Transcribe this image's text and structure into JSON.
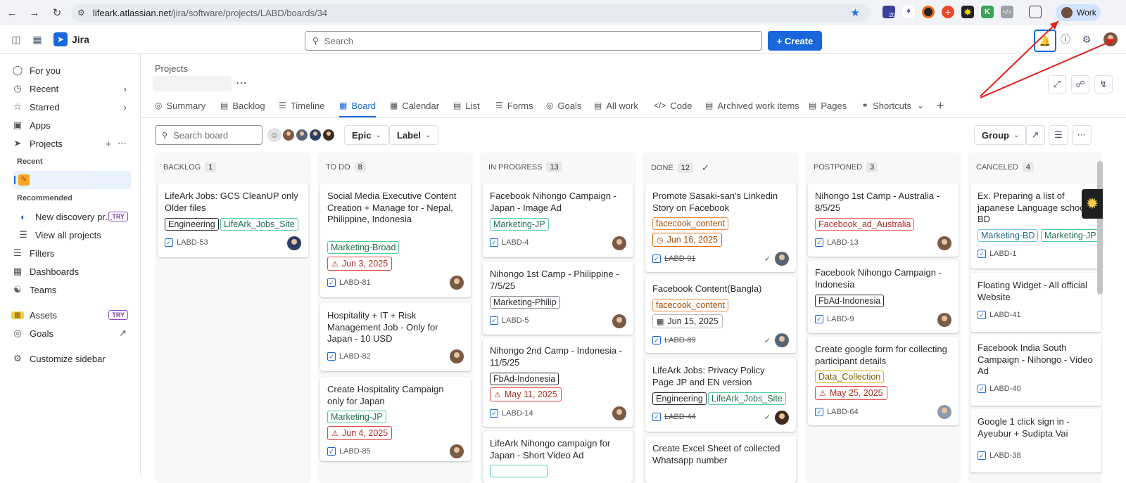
{
  "browser": {
    "url_host": "lifeark.atlassian.net",
    "url_path": "/jira/software/projects/LABD/boards/34",
    "ext_badge": "20",
    "profile_label": "Work"
  },
  "topbar": {
    "app_name": "Jira",
    "search_placeholder": "Search",
    "create_label": "Create"
  },
  "sidebar": {
    "for_you": "For you",
    "recent": "Recent",
    "starred": "Starred",
    "apps": "Apps",
    "projects": "Projects",
    "recent_label": "Recent",
    "recommended_label": "Recommended",
    "new_discovery": "New discovery pr...",
    "try": "TRY",
    "view_all": "View all projects",
    "filters": "Filters",
    "dashboards": "Dashboards",
    "teams": "Teams",
    "assets": "Assets",
    "goals": "Goals",
    "customize": "Customize sidebar"
  },
  "header": {
    "projects_label": "Projects"
  },
  "tabs": [
    "Summary",
    "Backlog",
    "Timeline",
    "Board",
    "Calendar",
    "List",
    "Forms",
    "Goals",
    "All work",
    "Code",
    "Archived work items",
    "Pages",
    "Shortcuts"
  ],
  "toolbar": {
    "search_placeholder": "Search board",
    "epic": "Epic",
    "label": "Label",
    "group": "Group"
  },
  "columns": [
    {
      "name": "BACKLOG",
      "count": "1",
      "cards": [
        {
          "title": "LifeArk Jobs: GCS CleanUP only Older files",
          "labels": [
            "Engineering",
            "LifeArk_Jobs_Site"
          ],
          "key": "LABD-53"
        }
      ]
    },
    {
      "name": "TO DO",
      "count": "8",
      "cards": [
        {
          "title": "Social Media Executive Content Creation + Manage for - Nepal, Philippine, Indonesia",
          "labels": [
            "Marketing-Broad"
          ],
          "due": "Jun 3, 2025",
          "key": "LABD-81"
        },
        {
          "title": "Hospitality + IT + Risk Management Job - Only for Japan - 10 USD",
          "key": "LABD-82"
        },
        {
          "title": "Create Hospitality Campaign only for Japan",
          "labels": [
            "Marketing-JP"
          ],
          "due": "Jun 4, 2025",
          "key": "LABD-85"
        }
      ]
    },
    {
      "name": "IN PROGRESS",
      "count": "13",
      "cards": [
        {
          "title": "Facebook Nihongo Campaign - Japan - Image Ad",
          "labels": [
            "Marketing-JP"
          ],
          "key": "LABD-4"
        },
        {
          "title": "Nihongo 1st Camp - Philippine - 7/5/25",
          "labels": [
            "Marketing-Philip"
          ],
          "key": "LABD-5"
        },
        {
          "title": "Nihongo 2nd Camp - Indonesia - 11/5/25",
          "labels": [
            "FbAd-Indonesia"
          ],
          "due": "May 11, 2025",
          "key": "LABD-14"
        },
        {
          "title": "LifeArk Nihongo campaign for Japan - Short Video Ad"
        }
      ]
    },
    {
      "name": "DONE",
      "count": "12",
      "cards": [
        {
          "title": "Promote Sasaki-san's Linkedin Story on Facebook",
          "labels": [
            "facecook_content"
          ],
          "due": "Jun 16, 2025",
          "key": "LABD-91"
        },
        {
          "title": "Facebook Content(Bangla)",
          "labels": [
            "facecook_content"
          ],
          "due": "Jun 15, 2025",
          "key": "LABD-89"
        },
        {
          "title": "LifeArk Jobs: Privacy Policy Page JP and EN version",
          "labels": [
            "Engineering",
            "LifeArk_Jobs_Site"
          ],
          "key": "LABD-44"
        },
        {
          "title": "Create Excel Sheet of collected Whatsapp number"
        }
      ]
    },
    {
      "name": "POSTPONED",
      "count": "3",
      "cards": [
        {
          "title": "Nihongo 1st Camp - Australia - 8/5/25",
          "labels": [
            "Facebook_ad_Australia"
          ],
          "key": "LABD-13"
        },
        {
          "title": "Facebook Nihongo Campaign - Indonesia",
          "labels": [
            "FbAd-Indonesia"
          ],
          "key": "LABD-9"
        },
        {
          "title": "Create google form for collecting participant details",
          "labels": [
            "Data_Collection"
          ],
          "due": "May 25, 2025",
          "key": "LABD-64"
        }
      ]
    },
    {
      "name": "CANCELED",
      "count": "4",
      "cards": [
        {
          "title": "Ex. Preparing a list of japanese Language school in BD",
          "labels": [
            "Marketing-BD",
            "Marketing-JP"
          ],
          "key": "LABD-1"
        },
        {
          "title": "Floating Widget - All official Website",
          "key": "LABD-41"
        },
        {
          "title": "Facebook India South Campaign - Nihongo - Video Ad",
          "key": "LABD-40"
        },
        {
          "title": "Google 1 click sign in - Ayeubur + Sudipta Vai",
          "key": "LABD-38"
        }
      ]
    }
  ],
  "colors": {
    "accent": "#1868db",
    "annotation_arrow": "#e0201b"
  }
}
